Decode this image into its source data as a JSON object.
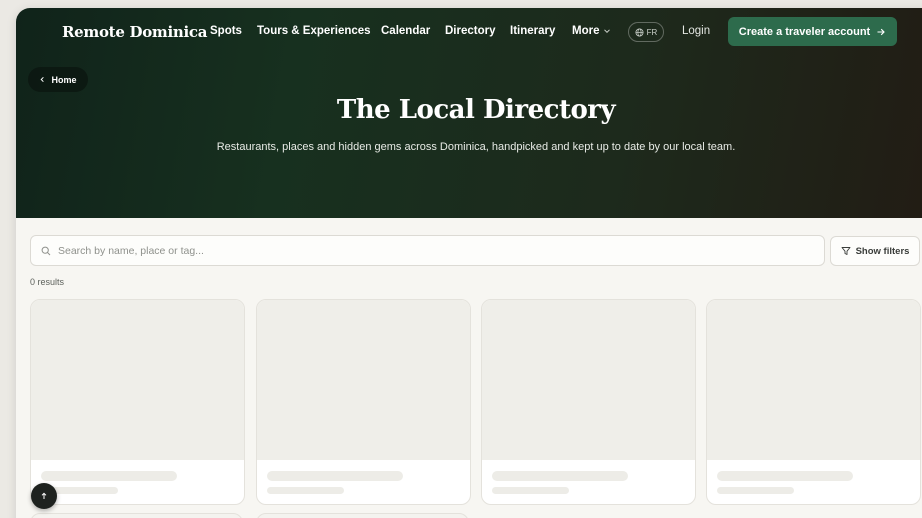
{
  "brand": "Remote Dominica",
  "nav": {
    "links": [
      "Spots",
      "Tours & Experiences",
      "Calendar",
      "Directory",
      "Itinerary",
      "More"
    ],
    "lang": "FR",
    "login": "Login",
    "cta": "Create a traveler account"
  },
  "breadcrumb": "Home",
  "hero": {
    "title": "The Local Directory",
    "subtitle": "Restaurants, places and hidden gems across Dominica, handpicked and kept up to date by our local team."
  },
  "search": {
    "placeholder": "Search by name, place or tag..."
  },
  "filters_label": "Show filters",
  "results_text": "0 results",
  "colors": {
    "cta": "#2d6b4c",
    "hero_dark": "#10231a"
  }
}
